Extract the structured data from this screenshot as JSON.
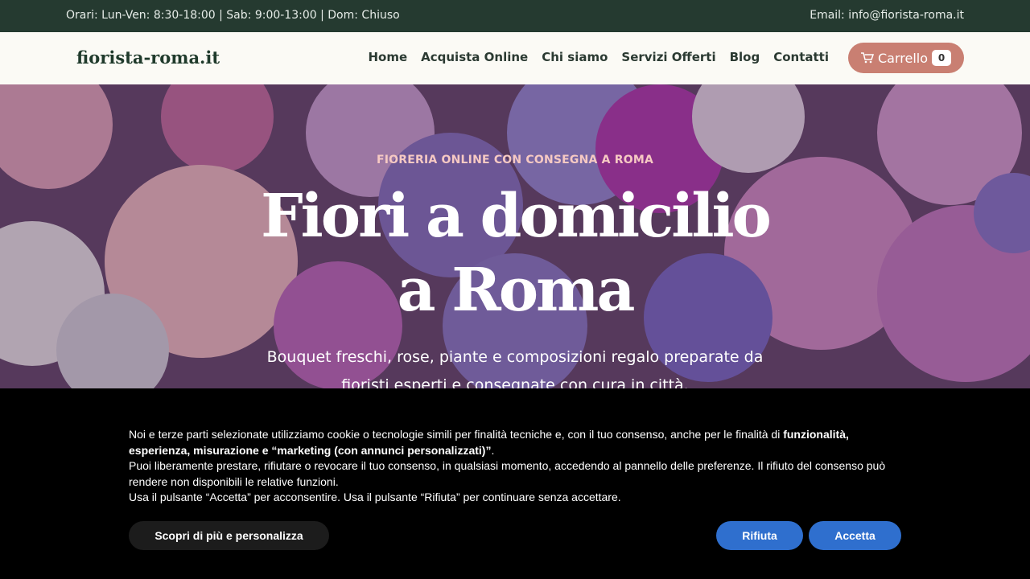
{
  "topbar": {
    "hours": "Orari: Lun-Ven: 8:30-18:00 | Sab: 9:00-13:00 | Dom: Chiuso",
    "email": "Email: info@fiorista-roma.it"
  },
  "header": {
    "logo": "fiorista-roma.it",
    "nav": [
      "Home",
      "Acquista Online",
      "Chi siamo",
      "Servizi Offerti",
      "Blog",
      "Contatti"
    ],
    "cart_label": "Carrello",
    "cart_count": "0"
  },
  "hero": {
    "eyebrow": "FIORERIA ONLINE CON CONSEGNA A ROMA",
    "title_line1": "Fiori a domicilio",
    "title_line2": "a Roma",
    "subtitle": "Bouquet freschi, rose, piante e composizioni regalo preparate da fioristi esperti e consegnate con cura in città."
  },
  "cookie": {
    "line1_a": "Noi e terze parti selezionate utilizziamo cookie o tecnologie simili per finalità tecniche e, con il tuo consenso, anche per le finalità di ",
    "line1_b": "funzionalità, esperienza, misurazione e “marketing (con annunci personalizzati)”",
    "line1_c": ".",
    "line2": "Puoi liberamente prestare, rifiutare o revocare il tuo consenso, in qualsiasi momento, accedendo al pannello delle preferenze. Il rifiuto del consenso può rendere non disponibili le relative funzioni.",
    "line3": "Usa il pulsante “Accetta” per acconsentire. Usa il pulsante “Rifiuta” per continuare senza accettare.",
    "more_button": "Scopri di più e personalizza",
    "reject_button": "Rifiuta",
    "accept_button": "Accetta"
  },
  "colors": {
    "topbar": "#253a30",
    "cart": "#c97f72",
    "button_blue": "#2f6fce",
    "eyebrow": "#f6c9c3"
  },
  "icons": {
    "cart": "cart-icon",
    "hero_background": "flowers-photo"
  }
}
